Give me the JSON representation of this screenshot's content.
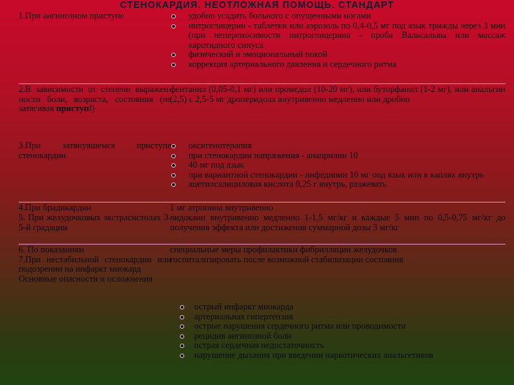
{
  "title": "СТЕНОКАРДИЯ. НЕОТЛОЖНАЯ ПОМОЩЬ. СТАНДАРТ",
  "rows": [
    {
      "left": [
        "1.При ангинозном приступе"
      ],
      "bullets": [
        "удобно усадить больного с опущенными ногами",
        "нитроглицерин - таблетки или аэрозоль по 0,4-0,5 мг под язык трижды через 3 мин (при непереносимости нитроглицерина - проба Вальсальвы или массаж каротидного синуса",
        "физический и эмоциональный покой",
        "коррекция артериального давления и сердечного ритма"
      ]
    },
    {
      "left_main": "2.В зависимости от степени выражен-ности боли, возраста, состояния (не затягивая",
      "left_bold": "приступ!",
      "left_tail": ")",
      "right": [
        "фентанил (0,05-0,1 мг) или промедол (10-20 мг), или буторфанол (1-2 мг), или анальгин (2,5) с 2,5-5 мг дроперидола внутривенно медленно или дробно"
      ]
    },
    {
      "left": [
        "3.При затянувшемся приступе стенокардии."
      ],
      "bullets": [
        "оксигенотерапия",
        "при стенокардии напряжения - анаприлин 10",
        "40 мг под язык",
        "при вариантной стенокардии - нифедипин 10 мг под язык или в каплях внутрь",
        "ацетилсалициловая кислота 0,25 г внутрь, разжевать"
      ]
    },
    {
      "left": [
        "4.При брадикардии"
      ],
      "right": [
        "1 мг атропина внутривенно"
      ]
    },
    {
      "left": [
        "5. При желудочковых экстрасистолах 3-5-й градации"
      ],
      "right": [
        "лидокаин внутривенно медленно 1-1,5 мг/кг и каждые 5 мин по 0,5-0,75 мг/кг до получения эффекта или достижения суммарной дозы 3 мг/кг"
      ]
    },
    {
      "left": [
        "6. По показаниям",
        "7.При нестабильной стенокардии или подозрении на инфаркт миокард",
        "Основные опасности и осложнения"
      ],
      "right": [
        "специальные меры профилактики фибрилляции желудочков",
        "госпитализировать после возможной стабилизации состояния"
      ],
      "bullets": [
        "острый инфаркт миокарда",
        "артериальная гипертензия",
        "острые нарушения сердечного ритма или проводимости",
        "рецидив ангинозной боли",
        "острая сердечная недостаточность",
        "нарушение дыхания при введении наркотических анальгетиков"
      ]
    }
  ]
}
